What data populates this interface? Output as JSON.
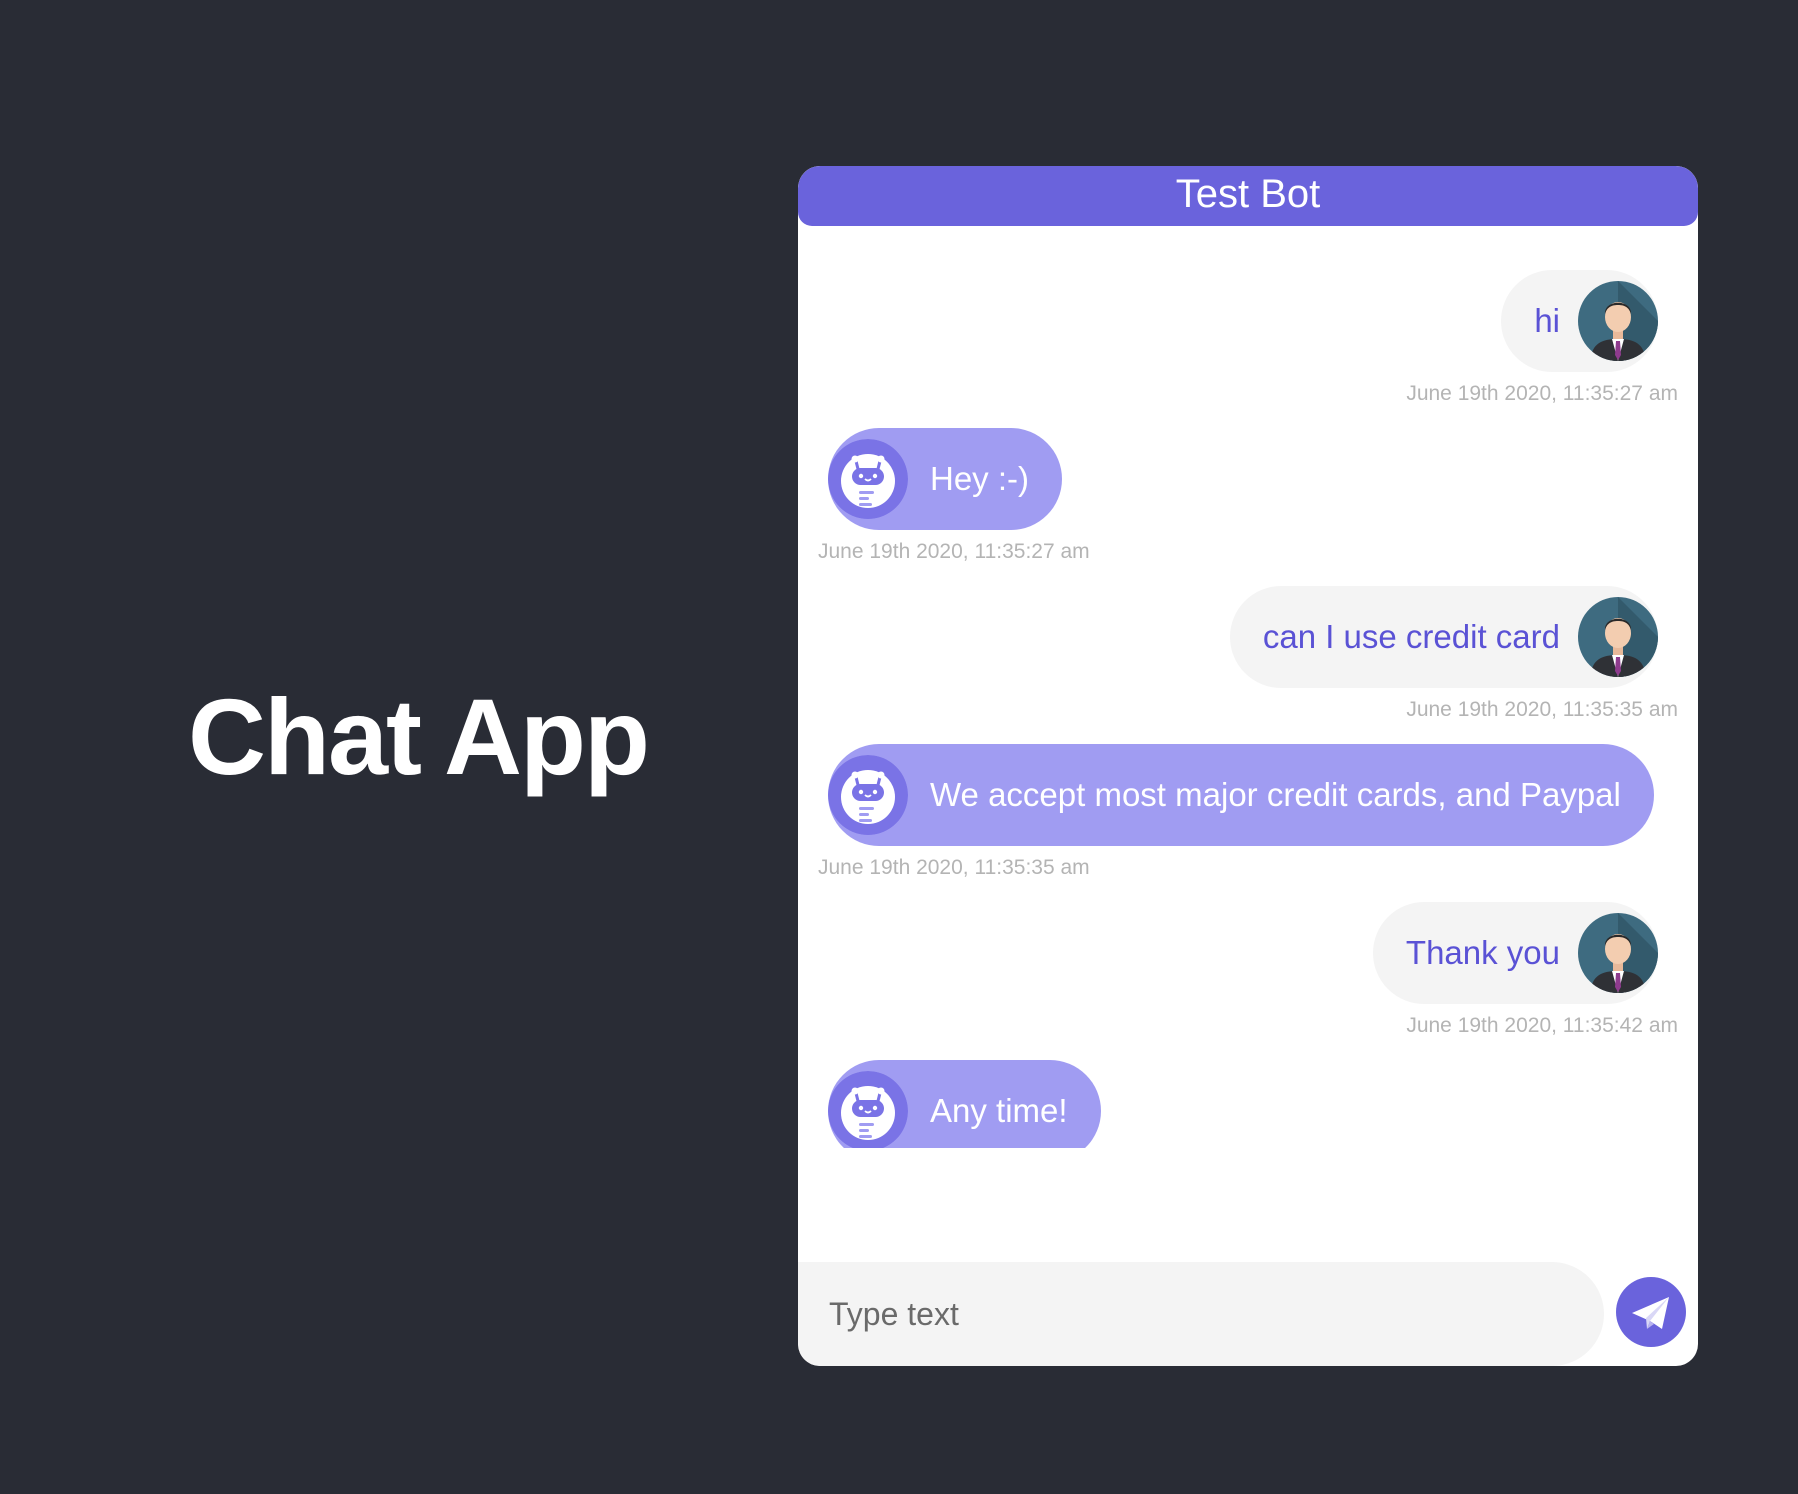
{
  "page": {
    "heading": "Chat App"
  },
  "chat": {
    "title": "Test Bot",
    "messages": [
      {
        "sender": "user",
        "text": "hi",
        "time": "June 19th 2020, 11:35:27 am"
      },
      {
        "sender": "bot",
        "text": "Hey :-)",
        "time": "June 19th 2020, 11:35:27 am"
      },
      {
        "sender": "user",
        "text": "can I use credit card",
        "time": "June 19th 2020, 11:35:35 am"
      },
      {
        "sender": "bot",
        "text": "We accept most major credit cards, and Paypal",
        "time": "June 19th 2020, 11:35:35 am"
      },
      {
        "sender": "user",
        "text": "Thank you",
        "time": "June 19th 2020, 11:35:42 am"
      },
      {
        "sender": "bot",
        "text": "Any time!",
        "time": ""
      }
    ],
    "composer": {
      "placeholder": "Type text",
      "value": ""
    }
  },
  "icons": {
    "user_avatar": "user-avatar-icon",
    "bot_avatar": "robot-avatar-icon",
    "send": "paper-plane-icon"
  },
  "colors": {
    "background": "#292c35",
    "header": "#6a63dc",
    "bot_bubble": "#a09cf2",
    "user_bubble": "#f4f4f4",
    "user_text": "#5a52d5",
    "timestamp": "#b4b4b4"
  }
}
